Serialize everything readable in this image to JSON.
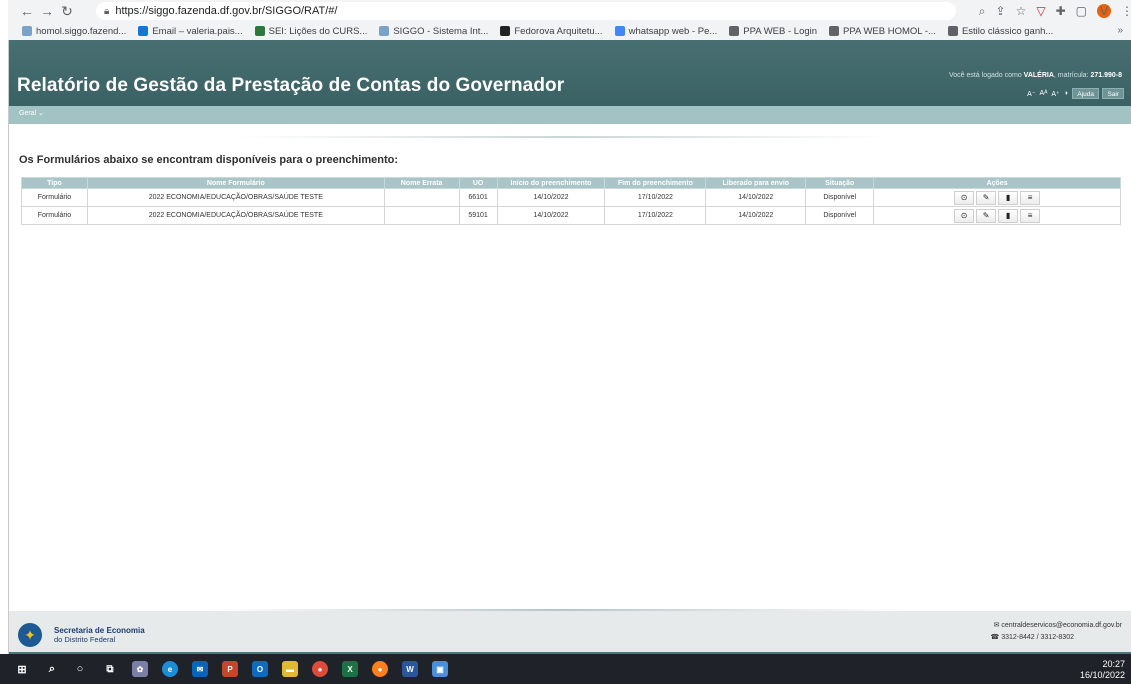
{
  "browser": {
    "url": "https://siggo.fazenda.df.gov.br/SIGGO/RAT/#/",
    "profile_initial": "V",
    "bookmarks": [
      {
        "label": "homol.siggo.fazend...",
        "icon": "siggo-icon",
        "color": "#7aa3c8"
      },
      {
        "label": "Email – valeria.pais...",
        "icon": "outlook-icon",
        "color": "#0f78d4"
      },
      {
        "label": "SEI: Lições do CURS...",
        "icon": "sei-icon",
        "color": "#2c7a3b"
      },
      {
        "label": "SIGGO - Sistema Int...",
        "icon": "siggo-icon",
        "color": "#7aa3c8"
      },
      {
        "label": "Fedorova Arquitetu...",
        "icon": "circle-icon",
        "color": "#222222"
      },
      {
        "label": "whatsapp web - Pe...",
        "icon": "google-icon",
        "color": "#4285f4"
      },
      {
        "label": "PPA WEB - Login",
        "icon": "globe-icon",
        "color": "#5f6368"
      },
      {
        "label": "PPA WEB HOMOL -...",
        "icon": "globe-icon",
        "color": "#5f6368"
      },
      {
        "label": "Estilo clássico ganh...",
        "icon": "page-icon",
        "color": "#5f6368"
      }
    ],
    "more_label": "»"
  },
  "header": {
    "title": "Relatório de Gestão da Prestação de Contas do Governador",
    "login_prefix": "Você está logado como ",
    "user": "VALÉRIA",
    "login_mid": ", matrícula: ",
    "matricula": "271.990-8",
    "font_controls": [
      "A⁻",
      "Aᴬ",
      "A⁺",
      "◑"
    ],
    "help_label": "Ajuda",
    "exit_label": "Sair"
  },
  "menu": {
    "item": "Geral"
  },
  "main": {
    "heading": "Os Formulários abaixo se encontram disponíveis para o preenchimento:",
    "columns": [
      "Tipo",
      "Nome Formulário",
      "Nome Errata",
      "UO",
      "Início do preenchimento",
      "Fim do preenchimento",
      "Liberado para envio",
      "Situação",
      "Ações"
    ],
    "rows": [
      {
        "tipo": "Formulário",
        "nome": "2022 ECONOMIA/EDUCAÇÃO/OBRAS/SAÚDE TESTE",
        "errata": "",
        "uo": "66101",
        "inicio": "14/10/2022",
        "fim": "17/10/2022",
        "liberado": "14/10/2022",
        "situacao": "Disponível"
      },
      {
        "tipo": "Formulário",
        "nome": "2022 ECONOMIA/EDUCAÇÃO/OBRAS/SAÚDE TESTE",
        "errata": "",
        "uo": "59101",
        "inicio": "14/10/2022",
        "fim": "17/10/2022",
        "liberado": "14/10/2022",
        "situacao": "Disponível"
      }
    ]
  },
  "footer": {
    "org_name": "Secretaria de Economia",
    "org_sub": "do Distrito Federal",
    "email": "centraldeservicos@economia.df.gov.br",
    "phone": "3312-8442 / 3312-8302"
  },
  "taskbar": {
    "time": "20:27",
    "date": "16/10/2022"
  }
}
